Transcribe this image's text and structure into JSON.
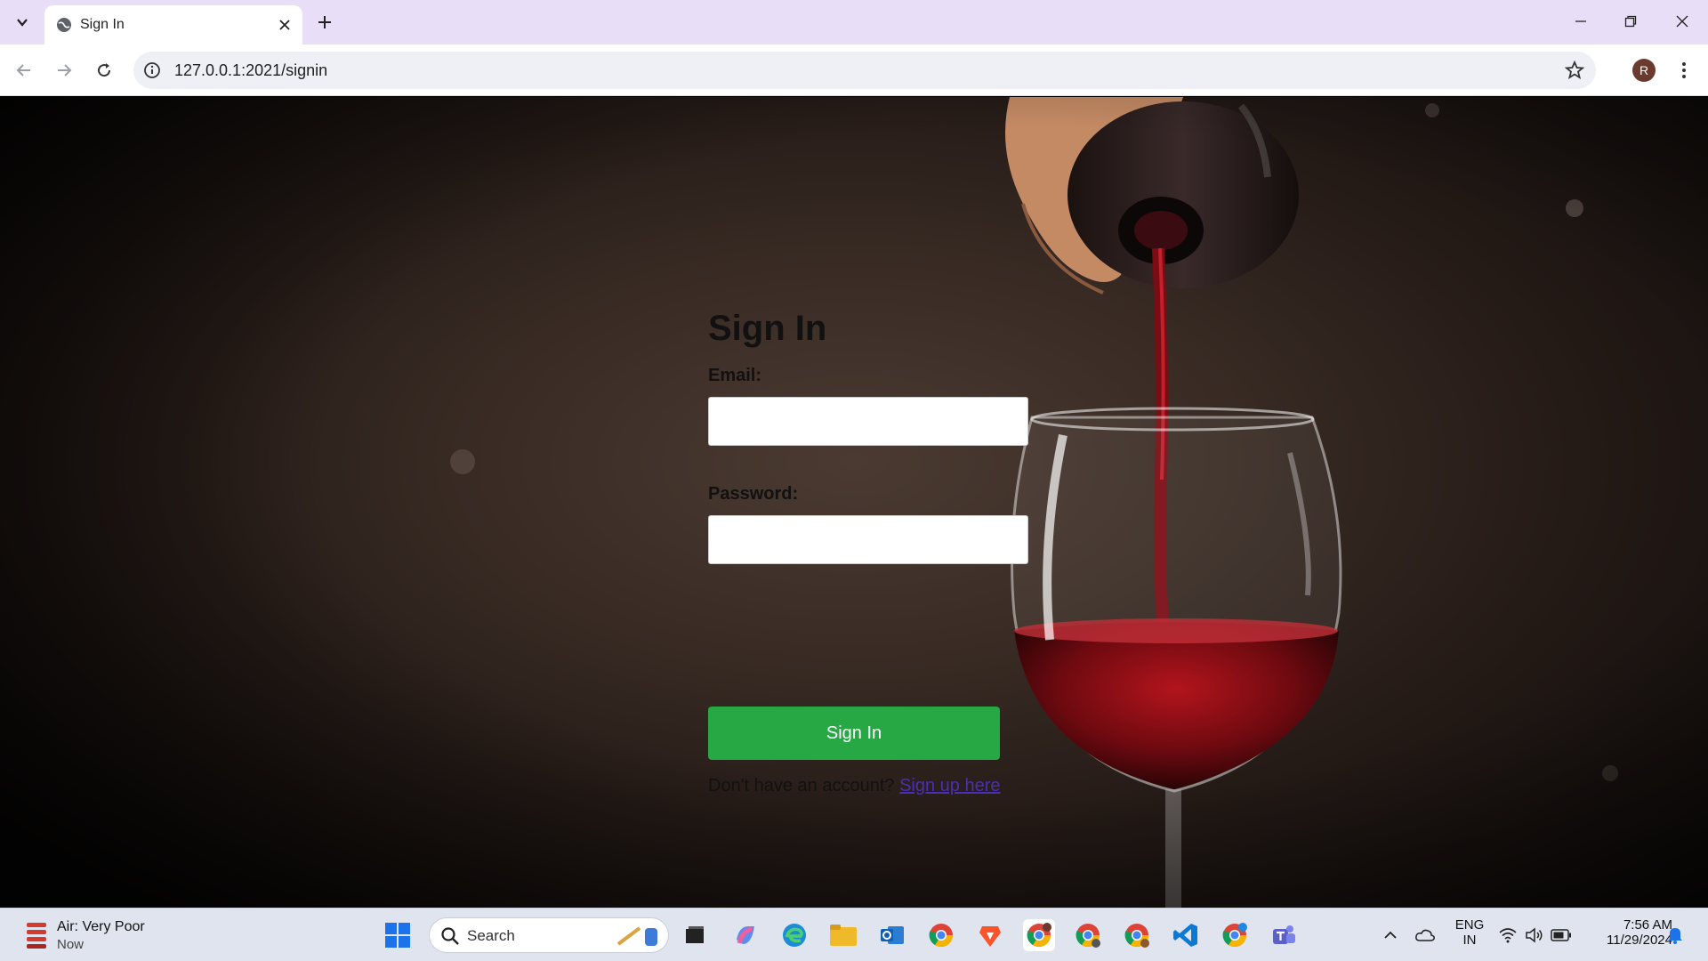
{
  "browser": {
    "tab_title": "Sign In",
    "url": "127.0.0.1:2021/signin",
    "profile_initial": "R"
  },
  "page": {
    "heading": "Sign In",
    "email_label": "Email:",
    "password_label": "Password:",
    "submit_label": "Sign In",
    "footer_prefix": "Don't have an account? ",
    "signup_link": "Sign up here"
  },
  "taskbar": {
    "weather_title": "Air: Very Poor",
    "weather_sub": "Now",
    "search_placeholder": "Search",
    "lang_line1": "ENG",
    "lang_line2": "IN",
    "time": "7:56 AM",
    "date": "11/29/2024"
  },
  "colors": {
    "primary_button": "#28a745",
    "tabbar": "#e8def8"
  }
}
